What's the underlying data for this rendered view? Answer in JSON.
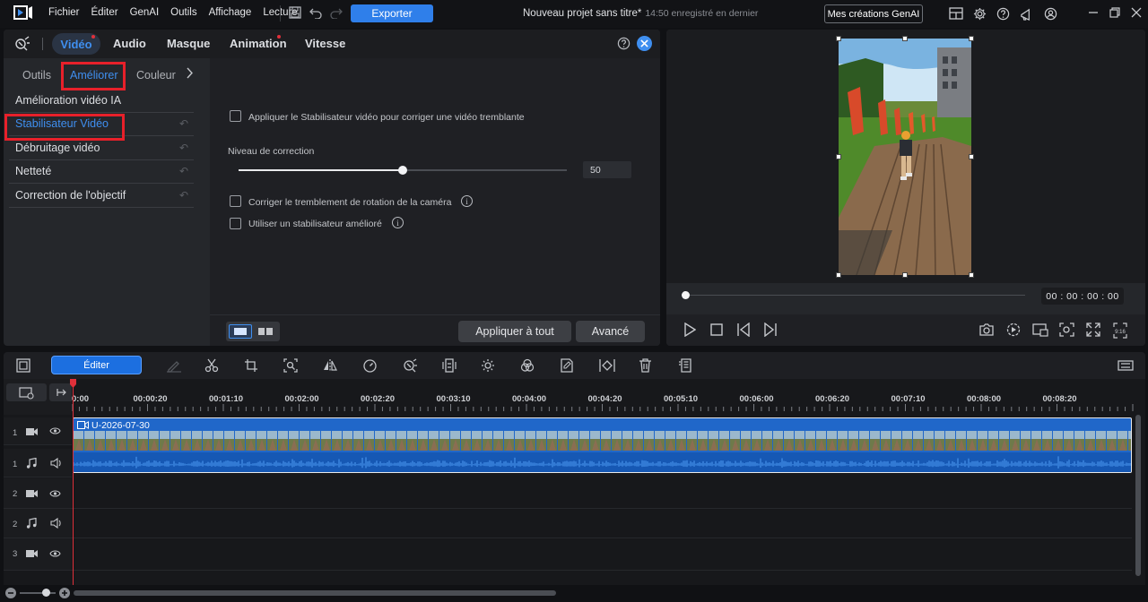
{
  "menubar": {
    "items": [
      "Fichier",
      "Éditer",
      "GenAI",
      "Outils",
      "Affichage",
      "Lecture"
    ],
    "export_label": "Exporter",
    "project_title": "Nouveau projet sans titre*",
    "project_saved": "14:50 enregistré en dernier",
    "genai_button": "Mes créations GenAI"
  },
  "left_panel": {
    "main_tabs": [
      "Vidéo",
      "Audio",
      "Masque",
      "Animation",
      "Vitesse"
    ],
    "active_main_tab": "Vidéo",
    "sub_tabs": [
      "Outils",
      "Améliorer",
      "Couleur"
    ],
    "active_sub_tab": "Améliorer",
    "fx_list": [
      {
        "label": "Amélioration vidéo IA",
        "selected": false
      },
      {
        "label": "Stabilisateur Vidéo",
        "selected": true
      },
      {
        "label": "Débruitage vidéo",
        "selected": false
      },
      {
        "label": "Netteté",
        "selected": false
      },
      {
        "label": "Correction de l'objectif",
        "selected": false
      }
    ],
    "stabilizer": {
      "apply_checkbox": "Appliquer le Stabilisateur vidéo pour corriger une vidéo tremblante",
      "correction_level_label": "Niveau de correction",
      "correction_level": 50,
      "correction_max": 100,
      "rotation_checkbox": "Corriger le tremblement de rotation de la caméra",
      "enhanced_checkbox": "Utiliser un stabilisateur amélioré"
    },
    "apply_all_label": "Appliquer à tout",
    "advanced_label": "Avancé"
  },
  "preview": {
    "timecode": "00 : 00 : 00 : 00",
    "progress": 0
  },
  "toolbar": {
    "edit_label": "Éditer"
  },
  "timeline": {
    "ruler_labels": [
      "0:00",
      "00:00:20",
      "00:01:10",
      "00:02:00",
      "00:02:20",
      "00:03:10",
      "00:04:00",
      "00:04:20",
      "00:05:10",
      "00:06:00",
      "00:06:20",
      "00:07:10",
      "00:08:00",
      "00:08:20"
    ],
    "tracks": [
      {
        "num": "1",
        "kind": "video"
      },
      {
        "num": "1",
        "kind": "audio"
      },
      {
        "num": "2",
        "kind": "video"
      },
      {
        "num": "2",
        "kind": "audio"
      },
      {
        "num": "3",
        "kind": "video"
      }
    ],
    "clip_name": "U-2026-07-30"
  },
  "colors": {
    "accent": "#3f8ff0",
    "highlight_box": "#e8202a",
    "export_button": "#2f7fea",
    "clip": "#2067c9",
    "playhead": "#e0303a"
  }
}
